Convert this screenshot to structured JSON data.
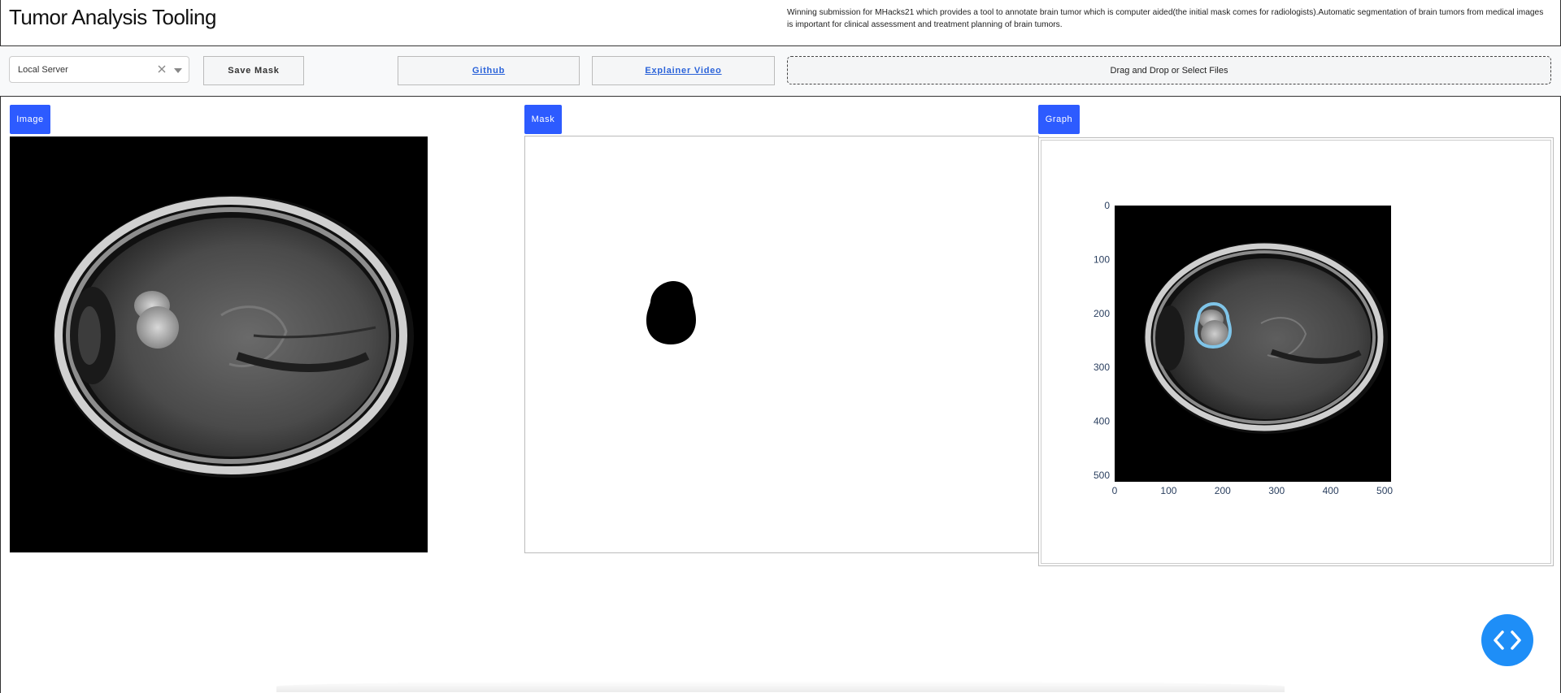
{
  "header": {
    "title": "Tumor Analysis Tooling",
    "description": "Winning submission for MHacks21 which provides a tool to annotate brain tumor which is computer aided(the initial mask comes for radiologists).Automatic segmentation of brain tumors from medical images is important for clinical assessment and treatment planning of brain tumors."
  },
  "toolbar": {
    "server_select_value": "Local Server",
    "save_mask_label": "Save Mask",
    "github_label": "Github",
    "video_label": "Explainer Video",
    "upload_label": "Drag and Drop or Select Files"
  },
  "panels": {
    "image_tab": "Image",
    "mask_tab": "Mask",
    "graph_tab": "Graph"
  },
  "graph": {
    "x_ticks": [
      "0",
      "100",
      "200",
      "300",
      "400",
      "500"
    ],
    "y_ticks": [
      "0",
      "100",
      "200",
      "300",
      "400",
      "500"
    ],
    "contour_color": "#7fc4e8"
  },
  "icons": {
    "clear": "close-icon",
    "dropdown": "chevron-down-icon",
    "fab": "code-icon"
  }
}
